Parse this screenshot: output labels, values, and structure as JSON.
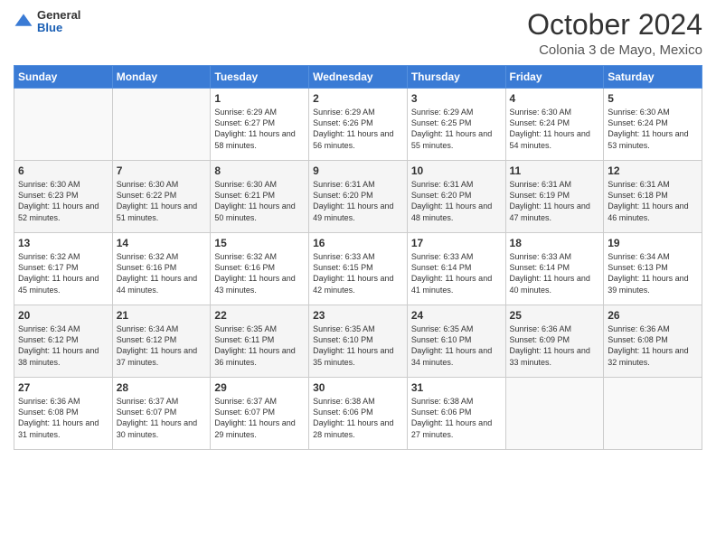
{
  "header": {
    "logo_general": "General",
    "logo_blue": "Blue",
    "month_title": "October 2024",
    "location": "Colonia 3 de Mayo, Mexico"
  },
  "days_of_week": [
    "Sunday",
    "Monday",
    "Tuesday",
    "Wednesday",
    "Thursday",
    "Friday",
    "Saturday"
  ],
  "weeks": [
    [
      {
        "day": "",
        "content": ""
      },
      {
        "day": "",
        "content": ""
      },
      {
        "day": "1",
        "content": "Sunrise: 6:29 AM\nSunset: 6:27 PM\nDaylight: 11 hours and 58 minutes."
      },
      {
        "day": "2",
        "content": "Sunrise: 6:29 AM\nSunset: 6:26 PM\nDaylight: 11 hours and 56 minutes."
      },
      {
        "day": "3",
        "content": "Sunrise: 6:29 AM\nSunset: 6:25 PM\nDaylight: 11 hours and 55 minutes."
      },
      {
        "day": "4",
        "content": "Sunrise: 6:30 AM\nSunset: 6:24 PM\nDaylight: 11 hours and 54 minutes."
      },
      {
        "day": "5",
        "content": "Sunrise: 6:30 AM\nSunset: 6:24 PM\nDaylight: 11 hours and 53 minutes."
      }
    ],
    [
      {
        "day": "6",
        "content": "Sunrise: 6:30 AM\nSunset: 6:23 PM\nDaylight: 11 hours and 52 minutes."
      },
      {
        "day": "7",
        "content": "Sunrise: 6:30 AM\nSunset: 6:22 PM\nDaylight: 11 hours and 51 minutes."
      },
      {
        "day": "8",
        "content": "Sunrise: 6:30 AM\nSunset: 6:21 PM\nDaylight: 11 hours and 50 minutes."
      },
      {
        "day": "9",
        "content": "Sunrise: 6:31 AM\nSunset: 6:20 PM\nDaylight: 11 hours and 49 minutes."
      },
      {
        "day": "10",
        "content": "Sunrise: 6:31 AM\nSunset: 6:20 PM\nDaylight: 11 hours and 48 minutes."
      },
      {
        "day": "11",
        "content": "Sunrise: 6:31 AM\nSunset: 6:19 PM\nDaylight: 11 hours and 47 minutes."
      },
      {
        "day": "12",
        "content": "Sunrise: 6:31 AM\nSunset: 6:18 PM\nDaylight: 11 hours and 46 minutes."
      }
    ],
    [
      {
        "day": "13",
        "content": "Sunrise: 6:32 AM\nSunset: 6:17 PM\nDaylight: 11 hours and 45 minutes."
      },
      {
        "day": "14",
        "content": "Sunrise: 6:32 AM\nSunset: 6:16 PM\nDaylight: 11 hours and 44 minutes."
      },
      {
        "day": "15",
        "content": "Sunrise: 6:32 AM\nSunset: 6:16 PM\nDaylight: 11 hours and 43 minutes."
      },
      {
        "day": "16",
        "content": "Sunrise: 6:33 AM\nSunset: 6:15 PM\nDaylight: 11 hours and 42 minutes."
      },
      {
        "day": "17",
        "content": "Sunrise: 6:33 AM\nSunset: 6:14 PM\nDaylight: 11 hours and 41 minutes."
      },
      {
        "day": "18",
        "content": "Sunrise: 6:33 AM\nSunset: 6:14 PM\nDaylight: 11 hours and 40 minutes."
      },
      {
        "day": "19",
        "content": "Sunrise: 6:34 AM\nSunset: 6:13 PM\nDaylight: 11 hours and 39 minutes."
      }
    ],
    [
      {
        "day": "20",
        "content": "Sunrise: 6:34 AM\nSunset: 6:12 PM\nDaylight: 11 hours and 38 minutes."
      },
      {
        "day": "21",
        "content": "Sunrise: 6:34 AM\nSunset: 6:12 PM\nDaylight: 11 hours and 37 minutes."
      },
      {
        "day": "22",
        "content": "Sunrise: 6:35 AM\nSunset: 6:11 PM\nDaylight: 11 hours and 36 minutes."
      },
      {
        "day": "23",
        "content": "Sunrise: 6:35 AM\nSunset: 6:10 PM\nDaylight: 11 hours and 35 minutes."
      },
      {
        "day": "24",
        "content": "Sunrise: 6:35 AM\nSunset: 6:10 PM\nDaylight: 11 hours and 34 minutes."
      },
      {
        "day": "25",
        "content": "Sunrise: 6:36 AM\nSunset: 6:09 PM\nDaylight: 11 hours and 33 minutes."
      },
      {
        "day": "26",
        "content": "Sunrise: 6:36 AM\nSunset: 6:08 PM\nDaylight: 11 hours and 32 minutes."
      }
    ],
    [
      {
        "day": "27",
        "content": "Sunrise: 6:36 AM\nSunset: 6:08 PM\nDaylight: 11 hours and 31 minutes."
      },
      {
        "day": "28",
        "content": "Sunrise: 6:37 AM\nSunset: 6:07 PM\nDaylight: 11 hours and 30 minutes."
      },
      {
        "day": "29",
        "content": "Sunrise: 6:37 AM\nSunset: 6:07 PM\nDaylight: 11 hours and 29 minutes."
      },
      {
        "day": "30",
        "content": "Sunrise: 6:38 AM\nSunset: 6:06 PM\nDaylight: 11 hours and 28 minutes."
      },
      {
        "day": "31",
        "content": "Sunrise: 6:38 AM\nSunset: 6:06 PM\nDaylight: 11 hours and 27 minutes."
      },
      {
        "day": "",
        "content": ""
      },
      {
        "day": "",
        "content": ""
      }
    ]
  ]
}
